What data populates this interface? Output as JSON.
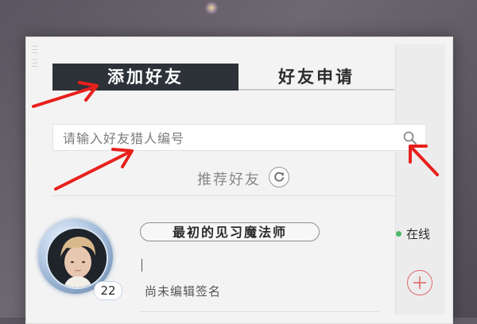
{
  "tabs": {
    "add_friend": "添加好友",
    "friend_requests": "好友申请"
  },
  "search": {
    "placeholder": "请输入好友猎人编号",
    "value": ""
  },
  "recommend": {
    "label": "推荐好友"
  },
  "friend": {
    "name": "最初的见习魔法师",
    "level": "22",
    "status": "在线",
    "signature": "尚未编辑签名"
  },
  "icons": {
    "search": "search-icon",
    "refresh": "refresh-icon",
    "add": "plus-icon"
  },
  "colors": {
    "active_tab_bg": "#2d3138",
    "online": "#4fb86a",
    "add_button": "#e06a6a",
    "annotation_arrow": "#e8201c"
  }
}
